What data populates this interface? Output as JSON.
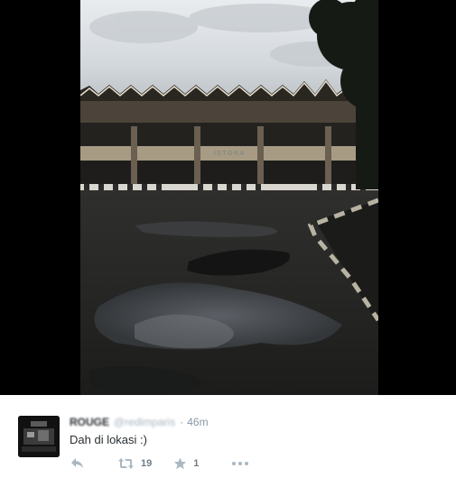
{
  "media": {
    "signage_text": "ISTORA"
  },
  "tweet": {
    "display_name": "ROUGE",
    "screen_name": "@redimparis",
    "separator": "·",
    "timestamp": "46m",
    "text": "Dah di lokasi :)",
    "retweet_count": "19",
    "favorite_count": "1"
  },
  "icons": {
    "reply": "reply-icon",
    "retweet": "retweet-icon",
    "favorite": "star-icon",
    "more": "more-dots-icon"
  },
  "colors": {
    "text": "#292f33",
    "muted": "#8899a6",
    "background": "#ffffff",
    "media_background": "#000000"
  }
}
